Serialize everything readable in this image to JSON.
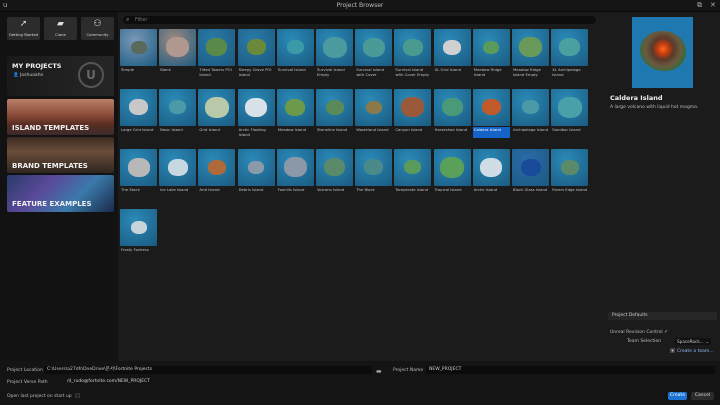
{
  "window": {
    "title": "Project Browser",
    "logo": "u",
    "restore_icon": "⧉",
    "close_icon": "✕"
  },
  "quick_buttons": [
    {
      "label": "Getting Started",
      "icon": "rocket-icon",
      "glyph": "➚"
    },
    {
      "label": "Clone",
      "icon": "folder-icon",
      "glyph": "▰"
    },
    {
      "label": "Community",
      "icon": "community-icon",
      "glyph": "⚇"
    }
  ],
  "categories": {
    "my_projects": {
      "label": "MY PROJECTS",
      "user": "Joshuaahn"
    },
    "island_templates": {
      "label": "ISLAND TEMPLATES"
    },
    "brand_templates": {
      "label": "BRAND TEMPLATES"
    },
    "feature_examples": {
      "label": "FEATURE EXAMPLES"
    }
  },
  "search": {
    "placeholder": "Filter"
  },
  "templates": [
    {
      "name": "Simple",
      "bg": "#7a98b8",
      "land": "#5a6a5a"
    },
    {
      "name": "Blank",
      "bg": "#a08a80",
      "land": "#b09890"
    },
    {
      "name": "Tilted Towers POI Island",
      "bg": "#2a7aa8",
      "land": "#5a8a4a"
    },
    {
      "name": "Sleepy Grove POI Island",
      "bg": "#2a7aa8",
      "land": "#6a8a3a"
    },
    {
      "name": "Survival Island",
      "bg": "#2a8ab8",
      "land": "#3a9aa8"
    },
    {
      "name": "Survival Island Empty",
      "bg": "#2a8ab8",
      "land": "#4a9aa0"
    },
    {
      "name": "Survival Island with Cover",
      "bg": "#2a8ab8",
      "land": "#4a9a98"
    },
    {
      "name": "Survival Island with Cover Empty",
      "bg": "#2a8ab8",
      "land": "#4a9a90"
    },
    {
      "name": "XL Grid Island",
      "bg": "#2a8ab8",
      "land": "#d0d0d0"
    },
    {
      "name": "Meadow Ridge Island",
      "bg": "#2a8ab8",
      "land": "#5a9a5a"
    },
    {
      "name": "Meadow Ridge Island Empty",
      "bg": "#2a8ab8",
      "land": "#6a9a5a"
    },
    {
      "name": "XL Archipelago Island",
      "bg": "#2a8ab8",
      "land": "#4aa0a0"
    },
    {
      "name": "Large Grid Island",
      "bg": "#2a8ab8",
      "land": "#c8c8c8"
    },
    {
      "name": "Basic Island",
      "bg": "#2a8ab8",
      "land": "#4a9aa8"
    },
    {
      "name": "Grid Island",
      "bg": "#2a8ab8",
      "land": "#b8c8a8"
    },
    {
      "name": "Arctic Floating Island",
      "bg": "#2a8ab8",
      "land": "#d8e0e8"
    },
    {
      "name": "Meadow Island",
      "bg": "#2a8ab8",
      "land": "#6a9a4a"
    },
    {
      "name": "Stoneline Island",
      "bg": "#2a8ab8",
      "land": "#5a8a5a"
    },
    {
      "name": "Wasteland Island",
      "bg": "#2a8ab8",
      "land": "#8a7a4a"
    },
    {
      "name": "Canyon Island",
      "bg": "#2a8ab8",
      "land": "#9a5a3a"
    },
    {
      "name": "Horseshoe Island",
      "bg": "#2a8ab8",
      "land": "#4a9a7a"
    },
    {
      "name": "Caldera Island",
      "bg": "#2a8ab8",
      "land": "#c05a2a",
      "selected": true
    },
    {
      "name": "Archipelago Island",
      "bg": "#2a8ab8",
      "land": "#4a9aa8"
    },
    {
      "name": "Sandbar Island",
      "bg": "#2a8ab8",
      "land": "#4aa0a8"
    },
    {
      "name": "The Stack",
      "bg": "#2a8ab8",
      "land": "#b8b8b8"
    },
    {
      "name": "Ice Lake Island",
      "bg": "#2a8ab8",
      "land": "#c8d8e0"
    },
    {
      "name": "Arid Island",
      "bg": "#2a8ab8",
      "land": "#b06a3a"
    },
    {
      "name": "Debris Island",
      "bg": "#2a8ab8",
      "land": "#8a9aa8"
    },
    {
      "name": "Foxhills Island",
      "bg": "#2a8ab8",
      "land": "#8a98a8"
    },
    {
      "name": "Volcano Island",
      "bg": "#2a8ab8",
      "land": "#5a8a6a"
    },
    {
      "name": "The Block",
      "bg": "#2a8ab8",
      "land": "#4a8a8a"
    },
    {
      "name": "Temperate Island",
      "bg": "#2a8ab8",
      "land": "#5a9a5a"
    },
    {
      "name": "Tropical Island",
      "bg": "#2a8ab8",
      "land": "#5aa05a"
    },
    {
      "name": "Arctic Island",
      "bg": "#2a8ab8",
      "land": "#d0dce6"
    },
    {
      "name": "Block Glass Island",
      "bg": "#2a6aa8",
      "land": "#1a4a9a"
    },
    {
      "name": "Rivers Edge Island",
      "bg": "#2a8ab8",
      "land": "#5a8a6a"
    },
    {
      "name": "Frosty Fortress",
      "bg": "#2a8ab8",
      "land": "#c8d4dc"
    }
  ],
  "preview": {
    "title": "Caldera Island",
    "description": "A large volcano with liquid hot magma."
  },
  "project_defaults": {
    "header": "Project Defaults",
    "revision_label": "Unreal Revision Control",
    "revision_checked": "✓",
    "team_label": "Team Selection",
    "team_value": "SpaceRock...",
    "create_team": "Create a team..."
  },
  "bottom": {
    "location_label": "Project Location",
    "location_value": "C:\\Users\\a27dh\\OneDrive\\문서\\Fortnite Projects",
    "name_label": "Project Name",
    "name_value": "NEW_PROJECT",
    "verse_label": "Project Verse Path",
    "verse_value": "/d_rudo@fortnite.com/NEW_PROJECT",
    "open_last_label": "Open last project on start up",
    "create_label": "Create",
    "cancel_label": "Cancel"
  }
}
